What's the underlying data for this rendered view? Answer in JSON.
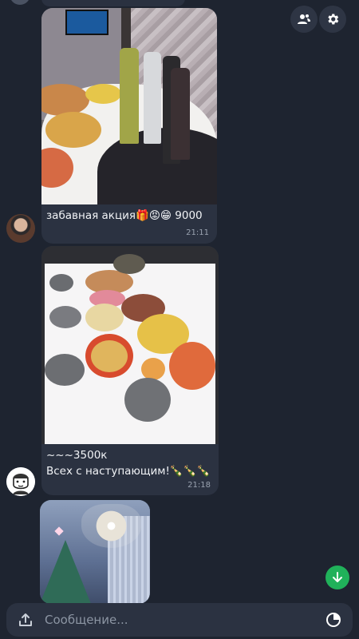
{
  "messages": {
    "photo1": {
      "time": "21:11"
    },
    "text1": {
      "text": "забавная акция🎁😡😁 9000",
      "time": "21:11"
    },
    "photo2": {
      "caption_line1": "~~~3500к",
      "caption_line2": "Всех с наступающим!🍾🍾🍾",
      "time": "21:18"
    }
  },
  "composer": {
    "placeholder": "Сообщение..."
  },
  "icons": {
    "contacts": "contacts-icon",
    "settings": "gear-icon",
    "scroll_down": "arrow-down-icon",
    "attach": "upload-icon",
    "sticker": "sticker-icon"
  },
  "colors": {
    "background": "#1e2430",
    "bubble": "#2b3241",
    "accent_green": "#20b15a"
  }
}
